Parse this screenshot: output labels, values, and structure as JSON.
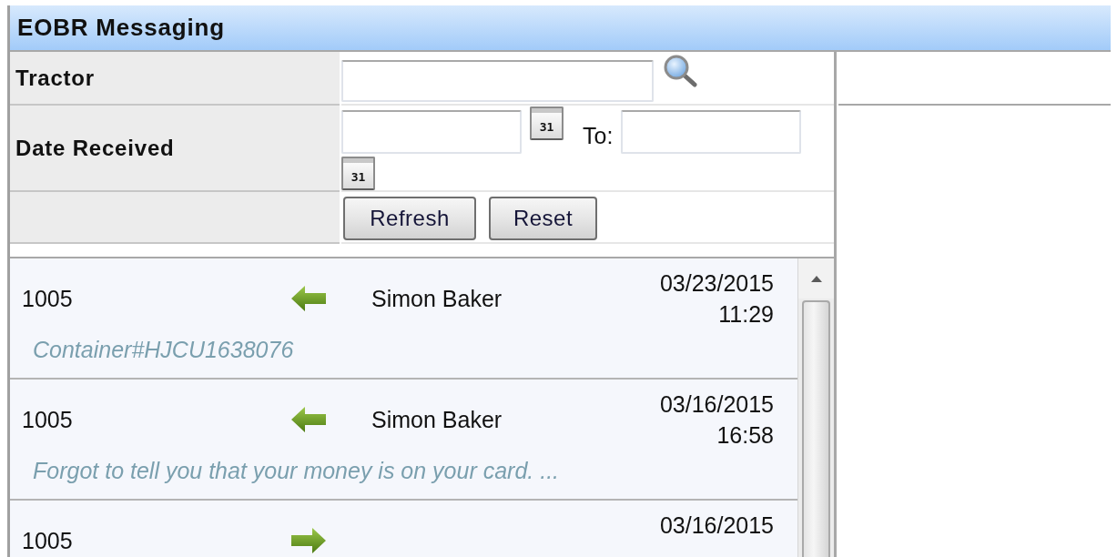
{
  "panel": {
    "title": "EOBR Messaging"
  },
  "filters": {
    "tractor": {
      "label": "Tractor"
    },
    "date_received": {
      "label": "Date Received",
      "from_calendar": "31",
      "to_label": "To:",
      "to_calendar": "31"
    },
    "buttons": [
      {
        "label": "Refresh"
      },
      {
        "label": "Reset"
      }
    ]
  },
  "messages": [
    {
      "kind": "incoming",
      "tractor": "1005",
      "sender": "Simon Baker",
      "date": "03/23/2015",
      "time": "11:29",
      "preview": "Container#HJCU1638076"
    },
    {
      "kind": "incoming",
      "tractor": "1005",
      "sender": "Simon Baker",
      "date": "03/16/2015",
      "time": "16:58",
      "preview": "Forgot to tell you that your money is on your card. ..."
    },
    {
      "kind": "outgoing",
      "tractor": "1005",
      "date": "03/16/2015"
    }
  ]
}
